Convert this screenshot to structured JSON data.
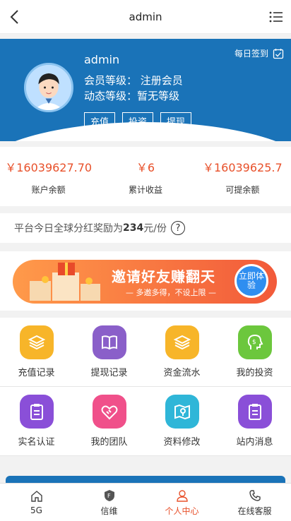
{
  "header": {
    "title": "admin"
  },
  "profile": {
    "checkin_label": "每日签到",
    "username": "admin",
    "member_level": "会员等级：   注册会员",
    "dynamic_level": "动态等级：暂无等级",
    "actions": [
      "充值",
      "投资",
      "提现"
    ]
  },
  "balances": [
    {
      "value": "￥16039627.70",
      "label": "账户余额"
    },
    {
      "value": "￥6",
      "label": "累计收益"
    },
    {
      "value": "￥16039625.7",
      "label": "可提余额"
    }
  ],
  "notice": {
    "prefix": "平台今日全球分红奖励为",
    "amount": "234",
    "suffix": "元/份",
    "help": "?"
  },
  "banner": {
    "main": "邀请好友赚翻天",
    "sub": "— 多邀多得，不设上限 —",
    "button": "立即体验"
  },
  "grid": [
    [
      {
        "label": "充值记录",
        "icon": "layers-icon",
        "color": "#f7b529"
      },
      {
        "label": "提现记录",
        "icon": "book-icon",
        "color": "#8a5fc9"
      },
      {
        "label": "资金流水",
        "icon": "layers-icon",
        "color": "#f7b529"
      },
      {
        "label": "我的投资",
        "icon": "head-dollar-icon",
        "color": "#6cc73d"
      }
    ],
    [
      {
        "label": "实名认证",
        "icon": "clipboard-icon",
        "color": "#8a4fd8"
      },
      {
        "label": "我的团队",
        "icon": "handshake-icon",
        "color": "#f0508a"
      },
      {
        "label": "资料修改",
        "icon": "map-pin-icon",
        "color": "#2fb6d8"
      },
      {
        "label": "站内消息",
        "icon": "clipboard-icon",
        "color": "#8a4fd8"
      }
    ]
  ],
  "tabs": [
    {
      "label": "5G",
      "icon": "home-icon",
      "active": false
    },
    {
      "label": "信维",
      "icon": "shield-icon",
      "active": false
    },
    {
      "label": "个人中心",
      "icon": "user-icon",
      "active": true
    },
    {
      "label": "在线客服",
      "icon": "phone-icon",
      "active": false
    }
  ],
  "colors": {
    "primary": "#1a73b8",
    "accent": "#e8502a"
  }
}
